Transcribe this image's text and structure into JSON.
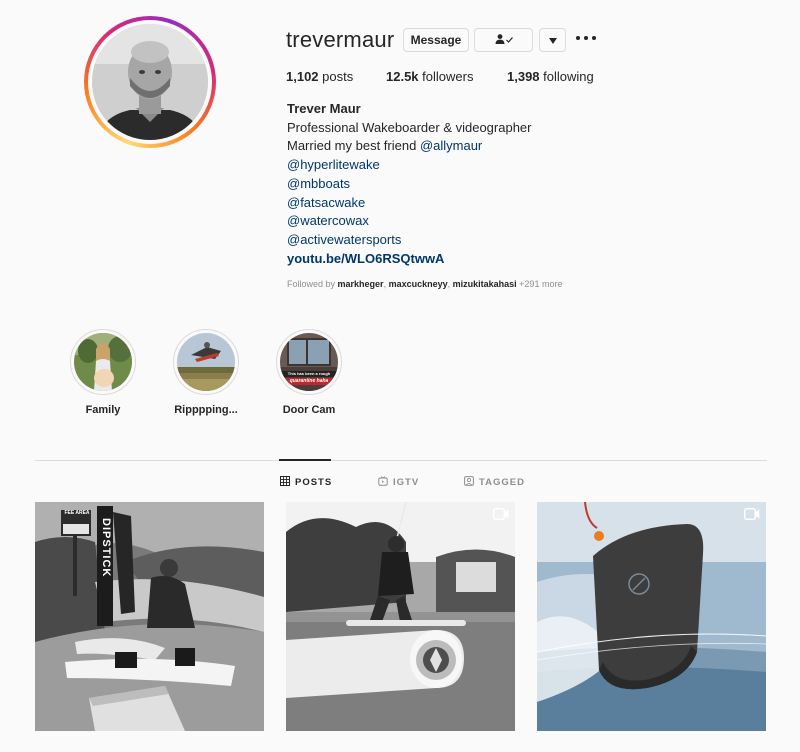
{
  "profile": {
    "username": "trevermaur",
    "message_label": "Message",
    "following_icon": "person-check-icon",
    "dropdown_icon": "caret-down-icon",
    "more_icon": "more-dots-icon"
  },
  "stats": {
    "posts_value": "1,102",
    "posts_label": "posts",
    "followers_value": "12.5k",
    "followers_label": "followers",
    "following_value": "1,398",
    "following_label": "following"
  },
  "bio": {
    "name": "Trever Maur",
    "line1": "Professional Wakeboarder & videographer",
    "line2_text": "Married my best friend ",
    "line2_mention": "@allymaur",
    "mentions": [
      "@hyperlitewake",
      "@mbboats",
      "@fatsacwake",
      "@watercowax",
      "@activewatersports"
    ],
    "url": "youtu.be/WLO6RSQtwwA"
  },
  "followed_by": {
    "prefix": "Followed by ",
    "users": [
      "markheger",
      "maxcuckneyy",
      "mizukitakahasi"
    ],
    "sep": ", ",
    "more": " +291 more"
  },
  "highlights": [
    {
      "label": "Family"
    },
    {
      "label": "Ripppping..."
    },
    {
      "label": "Door Cam",
      "overlay_text": [
        "This has been a rough",
        "quarantine haha"
      ]
    }
  ],
  "tabs": [
    {
      "label": "POSTS",
      "icon": "grid-icon",
      "active": true
    },
    {
      "label": "IGTV",
      "icon": "igtv-icon",
      "active": false
    },
    {
      "label": "TAGGED",
      "icon": "tagged-icon",
      "active": false
    }
  ],
  "posts": [
    {
      "sign_text": "DIPSTICK",
      "fee_text": "FEE AREA",
      "video": false
    },
    {
      "video": true,
      "icon": "video-icon"
    },
    {
      "video": true,
      "icon": "video-icon"
    }
  ],
  "colors": {
    "link": "#00376b",
    "text": "#262626",
    "muted": "#8e8e8e",
    "border": "#dbdbdb",
    "background": "#fafafa"
  }
}
